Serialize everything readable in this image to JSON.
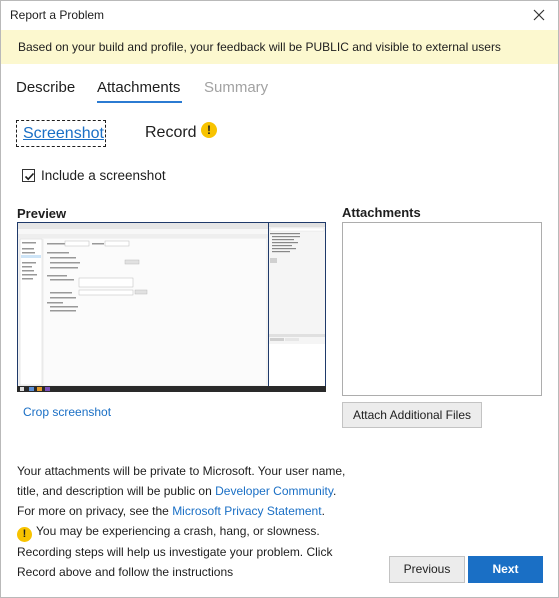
{
  "window": {
    "title": "Report a Problem"
  },
  "banner": {
    "text": "Based on your build and profile, your feedback will be PUBLIC and visible to external users"
  },
  "tabs": [
    {
      "label": "Describe",
      "state": "normal"
    },
    {
      "label": "Attachments",
      "state": "active"
    },
    {
      "label": "Summary",
      "state": "disabled"
    }
  ],
  "subtabs": {
    "screenshot": "Screenshot",
    "record": "Record"
  },
  "checkbox": {
    "label": "Include a screenshot",
    "checked": true
  },
  "preview": {
    "title": "Preview",
    "crop_link": "Crop screenshot"
  },
  "attachments": {
    "title": "Attachments",
    "button": "Attach Additional Files"
  },
  "info": {
    "line1": "Your attachments will be private to Microsoft. Your user name,",
    "line2_pre": "title, and description will be public on ",
    "line2_link": "Developer Community",
    "line2_post": ".",
    "line3_pre": "For more on privacy, see the ",
    "line3_link": "Microsoft Privacy Statement",
    "line3_post": ".",
    "line4": "You may be experiencing a crash, hang, or slowness.",
    "line5": "Recording steps will help us investigate your problem. Click",
    "line6": "Record above and follow the instructions"
  },
  "footer": {
    "previous": "Previous",
    "next": "Next"
  },
  "colors": {
    "accent": "#1a6fc5",
    "banner_bg": "#fcf8cf",
    "warning": "#f8c300"
  },
  "icons": {
    "close": "close-icon",
    "warning": "warning-icon",
    "check": "check-icon"
  }
}
